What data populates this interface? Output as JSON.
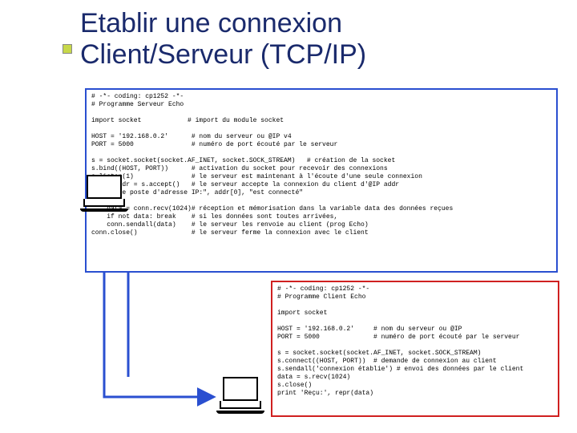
{
  "title_line1": "Etablir une connexion",
  "title_line2": "Client/Serveur (TCP/IP)",
  "server_code": "# -*- coding: cp1252 -*-\n# Programme Serveur Echo\n\nimport socket            # import du module socket\n\nHOST = '192.168.0.2'      # nom du serveur ou @IP v4\nPORT = 5000               # numéro de port écouté par le serveur\n\ns = socket.socket(socket.AF_INET, socket.SOCK_STREAM)   # création de la socket\ns.bind((HOST, PORT))      # activation du socket pour recevoir des connexions\ns.listen(1)               # le serveur est maintenant à l'écoute d'une seule connexion\nconn, addr = s.accept()   # le serveur accepte la connexion du client d'@IP addr\nprint \"Le poste d'adresse IP:\", addr[0], \"est connecté\"\nwhile 1:\n    data = conn.recv(1024)# réception et mémorisation dans la variable data des données reçues\n    if not data: break    # si les données sont toutes arrivées,\n    conn.sendall(data)    # le serveur les renvoie au client (prog Echo)\nconn.close()              # le serveur ferme la connexion avec le client",
  "client_code": "# -*- coding: cp1252 -*-\n# Programme Client Echo\n\nimport socket\n\nHOST = '192.168.0.2'     # nom du serveur ou @IP\nPORT = 5000              # numéro de port écouté par le serveur\n\ns = socket.socket(socket.AF_INET, socket.SOCK_STREAM)\ns.connect((HOST, PORT))  # demande de connexion au client\ns.sendall('connexion établie') # envoi des données par le client\ndata = s.recv(1024)\ns.close()\nprint 'Reçu:', repr(data)",
  "icons": {
    "server_laptop": "laptop-icon",
    "client_laptop": "laptop-icon"
  },
  "colors": {
    "title": "#1a2a6c",
    "server_border": "#2a4fd0",
    "client_border": "#d02020",
    "arrow": "#2a4fd0",
    "bullet": "#c7d84a"
  }
}
